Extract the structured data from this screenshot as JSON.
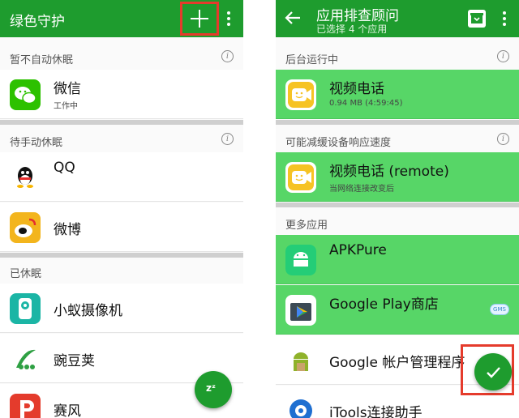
{
  "left": {
    "title": "绿色守护",
    "sections": [
      {
        "label": "暂不自动休眠",
        "apps": [
          {
            "name": "微信",
            "sub": "工作中",
            "icon": "wechat-icon"
          }
        ]
      },
      {
        "label": "待手动休眠",
        "apps": [
          {
            "name": "QQ",
            "icon": "qq-icon"
          },
          {
            "name": "微博",
            "icon": "weibo-icon"
          }
        ]
      },
      {
        "label": "已休眠",
        "apps": [
          {
            "name": "小蚁摄像机",
            "icon": "yi-camera-icon"
          },
          {
            "name": "豌豆荚",
            "icon": "wandoujia-icon"
          },
          {
            "name": "赛风",
            "icon": "psiphon-icon"
          }
        ]
      }
    ],
    "fab_label": "zᶻ"
  },
  "right": {
    "title": "应用排查顾问",
    "subtitle": "已选择 4 个应用",
    "sections": [
      {
        "label": "后台运行中",
        "apps": [
          {
            "name": "视频电话",
            "sub": "0.94 MB (4:59:45)",
            "icon": "video-call-icon",
            "selected": true
          }
        ]
      },
      {
        "label": "可能减缓设备响应速度",
        "apps": [
          {
            "name": "视频电话 (remote)",
            "sub": "当网络连接改变后",
            "icon": "video-call-icon",
            "selected": true
          }
        ]
      },
      {
        "label": "更多应用",
        "apps": [
          {
            "name": "APKPure",
            "icon": "apkpure-icon",
            "selected": true
          },
          {
            "name": "Google Play商店",
            "icon": "play-store-icon",
            "selected": true
          },
          {
            "name": "Google 帐户管理程序",
            "icon": "android-icon",
            "selected": false
          },
          {
            "name": "iTools连接助手",
            "icon": "itools-icon",
            "selected": false
          }
        ]
      }
    ]
  },
  "colors": {
    "toolbar": "#1e9c2e",
    "selected_row": "#57d667",
    "highlight_frame": "#e53b2c"
  }
}
